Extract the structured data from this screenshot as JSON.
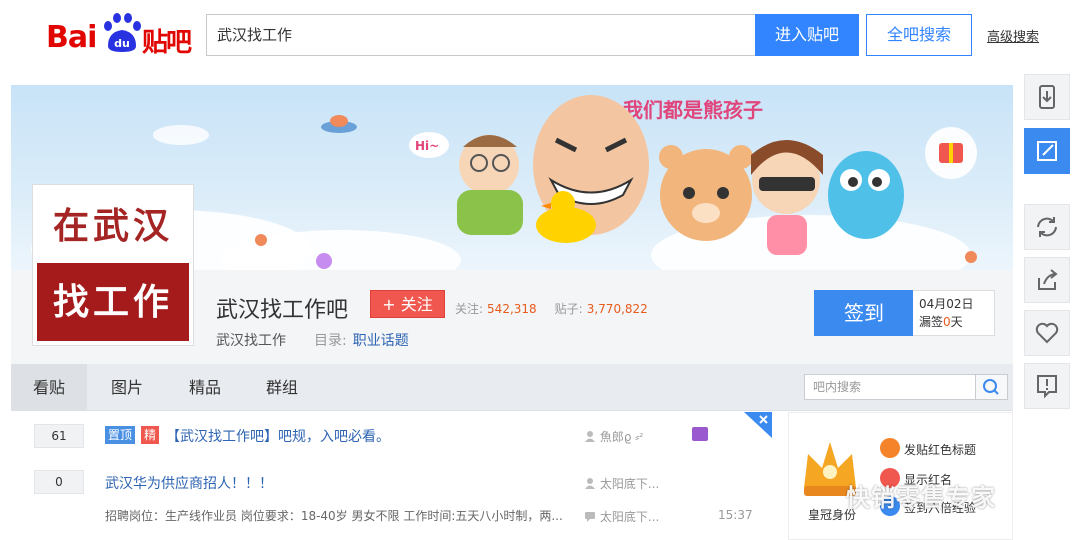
{
  "header": {
    "logo_bai": "Bai",
    "logo_du": "du",
    "logo_tieba": "贴吧",
    "search_value": "武汉找工作",
    "enter_button": "进入贴吧",
    "all_search_button": "全吧搜索",
    "advanced_search": "高级搜索"
  },
  "banner": {
    "slogan": "我们都是熊孩子",
    "hi_text": "Hi~"
  },
  "forum": {
    "avatar_top": "在武汉",
    "avatar_bottom": "找工作",
    "name": "武汉找工作吧",
    "follow_button": "+ 关注",
    "followers_label": "关注:",
    "followers": "542,318",
    "posts_label": "贴子:",
    "posts": "3,770,822",
    "short_name": "武汉找工作",
    "directory_label": "目录:",
    "category": "职业话题",
    "signin_button": "签到",
    "signin_date": "04月02日",
    "missed_label": "漏签",
    "missed_days": "0",
    "missed_unit": "天"
  },
  "tabs": [
    "看贴",
    "图片",
    "精品",
    "群组"
  ],
  "forum_search_placeholder": "吧内搜索",
  "threads": [
    {
      "replies": "61",
      "tag_top": "置顶",
      "tag_good": "精",
      "title": "【武汉找工作吧】吧规，入吧必看。",
      "author": "魚郎ϱ ⸗ᶻ"
    },
    {
      "replies": "0",
      "title": "武汉华为供应商招人！！！",
      "author": "太阳底下...",
      "abstract": "招聘岗位：生产线作业员 岗位要求：18-40岁 男女不限 工作时间:五天八小时制，两...",
      "last_reply_author": "太阳底下...",
      "time": "15:37"
    }
  ],
  "side": {
    "crown_label": "皇冠身份",
    "perks": [
      "发贴红色标题",
      "显示红名",
      "签到六倍经验"
    ]
  },
  "watermark": "快销零售专家",
  "icons": {
    "rail": [
      "phone-icon",
      "edit-icon",
      "refresh-icon",
      "share-icon",
      "heart-icon",
      "report-icon"
    ],
    "search": "search-icon",
    "close": "close-icon"
  },
  "colors": {
    "accent_blue": "#3385ff",
    "brand_red": "#e10601",
    "follow_red": "#f0584f",
    "link_blue": "#2d64b3"
  }
}
